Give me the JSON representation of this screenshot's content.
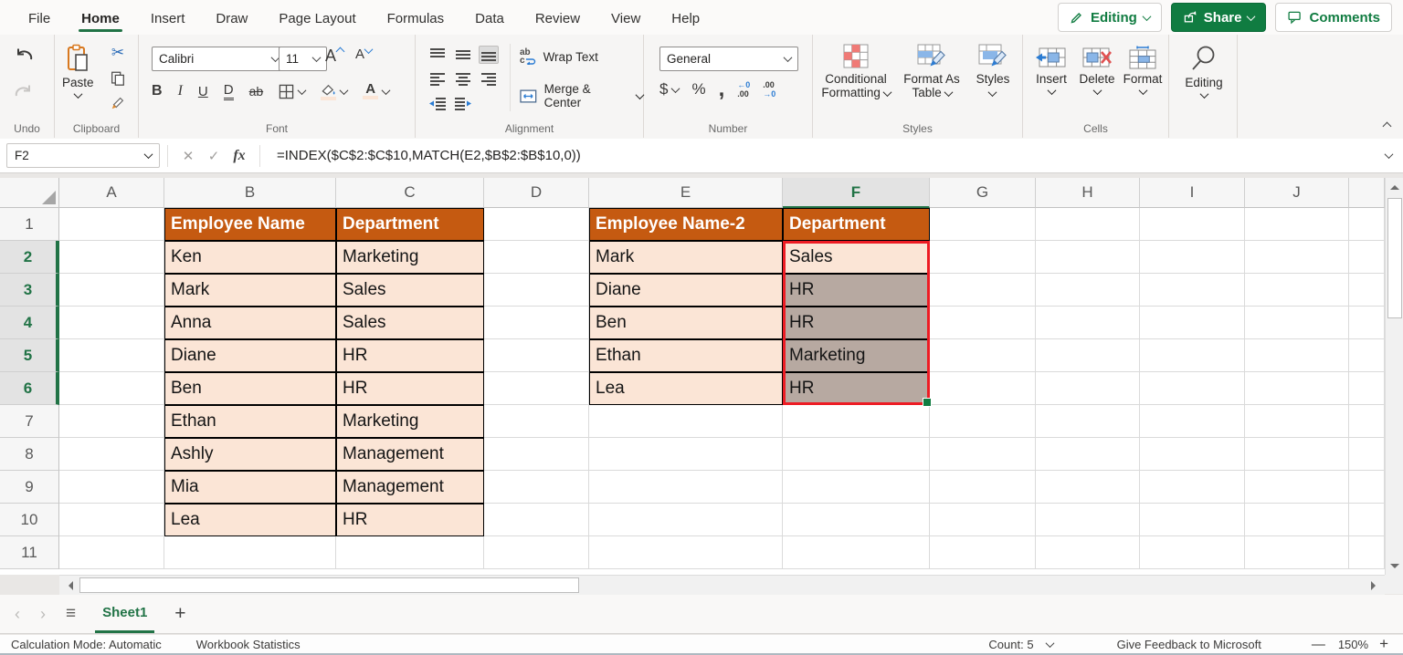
{
  "tabs": {
    "items": [
      "File",
      "Home",
      "Insert",
      "Draw",
      "Page Layout",
      "Formulas",
      "Data",
      "Review",
      "View",
      "Help"
    ],
    "active": "Home"
  },
  "top_actions": {
    "editing": "Editing",
    "share": "Share",
    "comments": "Comments"
  },
  "ribbon": {
    "undo": {
      "label": "Undo"
    },
    "clipboard": {
      "label": "Clipboard",
      "paste": "Paste"
    },
    "font": {
      "label": "Font",
      "family": "Calibri",
      "size": "11"
    },
    "alignment": {
      "label": "Alignment",
      "wrap_text": "Wrap Text",
      "merge_center": "Merge & Center"
    },
    "number": {
      "label": "Number",
      "format": "General"
    },
    "styles": {
      "label": "Styles",
      "conditional_l1": "Conditional",
      "conditional_l2": "Formatting",
      "format_table_l1": "Format As",
      "format_table_l2": "Table",
      "styles_btn": "Styles"
    },
    "cells": {
      "label": "Cells",
      "insert": "Insert",
      "del": "Delete",
      "format": "Format"
    },
    "editing": {
      "label": "Editing"
    }
  },
  "icons": {
    "scissors": "✂",
    "cancel": "✕",
    "confirm": "✓",
    "fx": "fx",
    "bold": "B",
    "italic": "I",
    "underline": "U",
    "double_underline": "D",
    "strike": "ab",
    "letter_a": "A",
    "dollar": "$",
    "percent": "%",
    "comma": ",",
    "dec_inc_top": "←0",
    "dec_inc_bot": ".00",
    "dec_dec_top": ".00",
    "dec_dec_bot": "→0",
    "wrap_ab": "ab",
    "wrap_c": "c",
    "prev": "‹",
    "next": "›",
    "hamburger": "≡",
    "add_sheet": "+",
    "zoom_out": "—",
    "zoom_in": "+"
  },
  "formula_bar": {
    "name_box": "F2",
    "formula": "=INDEX($C$2:$C$10,MATCH(E2,$B$2:$B$10,0))"
  },
  "grid": {
    "columns": [
      "A",
      "B",
      "C",
      "D",
      "E",
      "F",
      "G",
      "H",
      "I",
      "J"
    ],
    "rows": [
      "1",
      "2",
      "3",
      "4",
      "5",
      "6",
      "7",
      "8",
      "9",
      "10",
      "11"
    ],
    "selected_column": "F",
    "selected_rows": [
      "2",
      "3",
      "4",
      "5",
      "6"
    ],
    "tables": [
      {
        "start_col": "B",
        "headers": [
          "Employee Name",
          "Department"
        ],
        "rows": [
          [
            "Ken",
            "Marketing"
          ],
          [
            "Mark",
            "Sales"
          ],
          [
            "Anna",
            "Sales"
          ],
          [
            "Diane",
            "HR"
          ],
          [
            "Ben",
            "HR"
          ],
          [
            "Ethan",
            "Marketing"
          ],
          [
            "Ashly",
            "Management"
          ],
          [
            "Mia",
            "Management"
          ],
          [
            "Lea",
            "HR"
          ]
        ]
      },
      {
        "start_col": "E",
        "headers": [
          "Employee Name-2",
          "Department"
        ],
        "rows": [
          [
            "Mark",
            "Sales"
          ],
          [
            "Diane",
            "HR"
          ],
          [
            "Ben",
            "HR"
          ],
          [
            "Ethan",
            "Marketing"
          ],
          [
            "Lea",
            "HR"
          ]
        ]
      }
    ],
    "selection": {
      "range": "F2:F6",
      "active_cell": "F2",
      "overlay_cells": [
        "F3",
        "F4",
        "F5",
        "F6"
      ]
    }
  },
  "sheet_bar": {
    "sheet": "Sheet1"
  },
  "status_bar": {
    "calc_mode": "Calculation Mode: Automatic",
    "workbook_stats": "Workbook Statistics",
    "count": "Count: 5",
    "feedback": "Give Feedback to Microsoft",
    "zoom": "150%"
  },
  "colors": {
    "accent_green": "#217346",
    "button_green": "#107C41",
    "header_orange": "#C55A11",
    "cell_fill": "#FBE5D6",
    "selection_fill": "#B7A9A1",
    "selection_border": "#ED1C24"
  }
}
